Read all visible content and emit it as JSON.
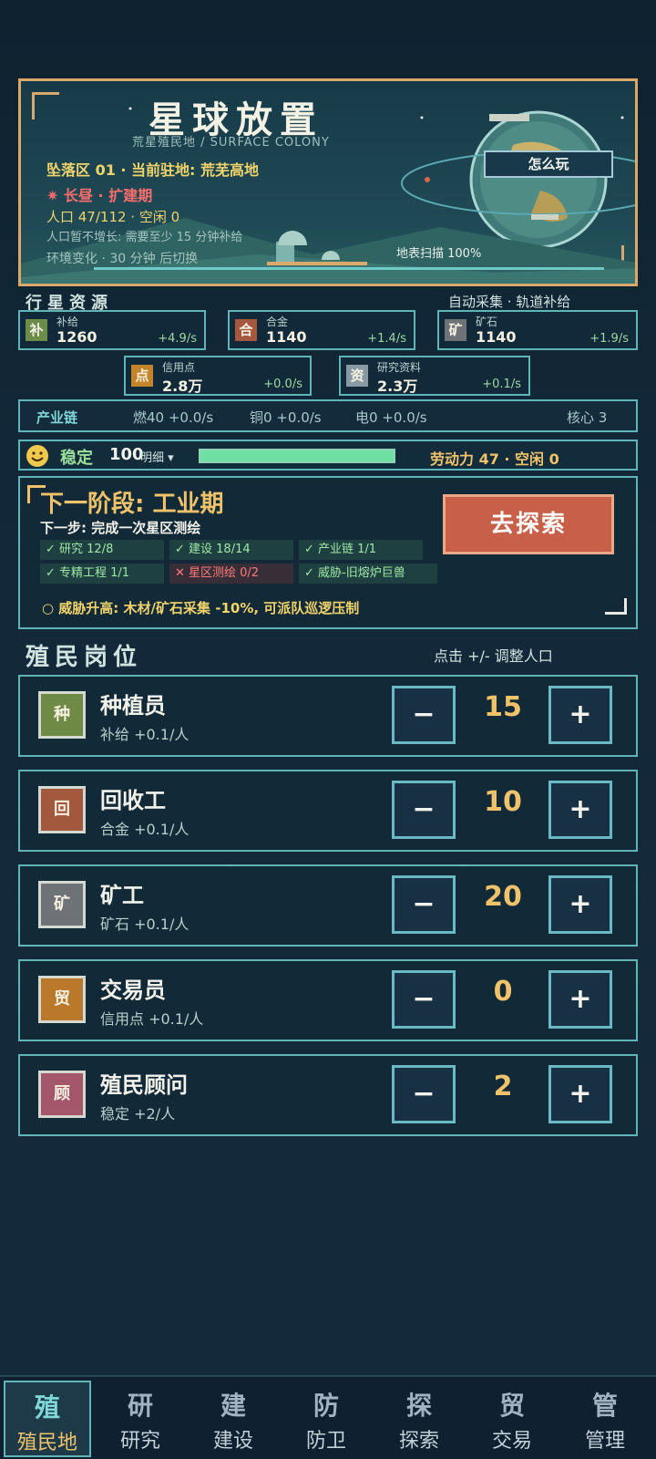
{
  "hero": {
    "title": "星球放置",
    "subtitle": "荒星殖民地 / SURFACE COLONY",
    "zone": "坠落区 01 · 当前驻地: 荒芜高地",
    "phase": "✷ 长昼 · 扩建期",
    "population": "人口 47/112 · 空闲 0",
    "pop_note": "人口暂不增长: 需要至少 15 分钟补给",
    "env": "环境变化 · 30 分钟 后切换",
    "scan": "地表扫描 100%",
    "howto": "怎么玩"
  },
  "resources_header": {
    "title": "行星资源",
    "right": "自动采集 · 轨道补给"
  },
  "resources": [
    {
      "icon": "补",
      "name": "补给",
      "value": "1260",
      "rate": "+4.9/s",
      "color": "#6b8c4a"
    },
    {
      "icon": "合",
      "name": "合金",
      "value": "1140",
      "rate": "+1.4/s",
      "color": "#a5583e"
    },
    {
      "icon": "矿",
      "name": "矿石",
      "value": "1140",
      "rate": "+1.9/s",
      "color": "#6f7276"
    },
    {
      "icon": "点",
      "name": "信用点",
      "value": "2.8万",
      "rate": "+0.0/s",
      "color": "#c4842a"
    },
    {
      "icon": "资",
      "name": "研究资料",
      "value": "2.3万",
      "rate": "+0.1/s",
      "color": "#8a9aa4"
    }
  ],
  "chain": {
    "label": "产业链",
    "fuel": "燃40 +0.0/s",
    "copper": "铜0 +0.0/s",
    "power": "电0 +0.0/s",
    "core": "核心 3"
  },
  "stability": {
    "label": "稳定",
    "value": "100",
    "detail": "明细 ▾",
    "level": 1.0,
    "labor": "劳动力 47 · 空闲 0"
  },
  "stage": {
    "title": "下一阶段: 工业期",
    "step": "下一步: 完成一次星区测绘",
    "tags": [
      {
        "text": "✓ 研究 12/8",
        "ok": true
      },
      {
        "text": "✓ 建设 18/14",
        "ok": true
      },
      {
        "text": "✓ 产业链 1/1",
        "ok": true
      },
      {
        "text": "✓ 专精工程 1/1",
        "ok": true
      },
      {
        "text": "✕ 星区测绘 0/2",
        "ok": false
      },
      {
        "text": "✓ 威胁-旧熔炉巨兽",
        "ok": true
      }
    ],
    "threat": "○ 威胁升高: 木材/矿石采集 -10%, 可派队巡逻压制",
    "explore": "去探索"
  },
  "jobs_header": {
    "title": "殖民岗位",
    "right": "点击 +/- 调整人口"
  },
  "jobs": [
    {
      "icon": "种",
      "name": "种植员",
      "desc": "补给 +0.1/人",
      "count": "15",
      "color": "#6e8a45"
    },
    {
      "icon": "回",
      "name": "回收工",
      "desc": "合金 +0.1/人",
      "count": "10",
      "color": "#a3573c"
    },
    {
      "icon": "矿",
      "name": "矿工",
      "desc": "矿石 +0.1/人",
      "count": "20",
      "color": "#6f7377"
    },
    {
      "icon": "贸",
      "name": "交易员",
      "desc": "信用点 +0.1/人",
      "count": "0",
      "color": "#b9782a"
    },
    {
      "icon": "顾",
      "name": "殖民顾问",
      "desc": "稳定 +2/人",
      "count": "2",
      "color": "#a4566a"
    }
  ],
  "nav": [
    {
      "big": "殖",
      "label": "殖民地"
    },
    {
      "big": "研",
      "label": "研究"
    },
    {
      "big": "建",
      "label": "建设"
    },
    {
      "big": "防",
      "label": "防卫"
    },
    {
      "big": "探",
      "label": "探索"
    },
    {
      "big": "贸",
      "label": "交易"
    },
    {
      "big": "管",
      "label": "管理"
    }
  ]
}
